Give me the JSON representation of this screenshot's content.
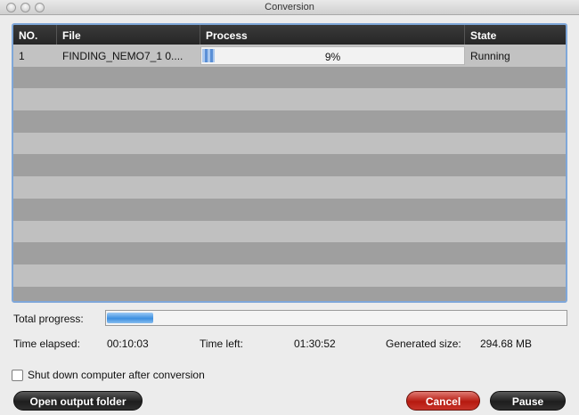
{
  "window": {
    "title": "Conversion"
  },
  "table": {
    "columns": [
      "NO.",
      "File",
      "Process",
      "State"
    ],
    "rows": [
      {
        "no": "1",
        "file": "FINDING_NEMO7_1 0....",
        "process": 0.09,
        "process_label": "9%",
        "state": "Running"
      }
    ]
  },
  "progress": {
    "label": "Total progress:",
    "value": 0.1
  },
  "stats": {
    "elapsed_label": "Time elapsed:",
    "elapsed_value": "00:10:03",
    "left_label": "Time left:",
    "left_value": "01:30:52",
    "size_label": "Generated size:",
    "size_value": "294.68 MB"
  },
  "options": {
    "shutdown_label": "Shut down computer after conversion",
    "shutdown_checked": false
  },
  "buttons": {
    "open_folder": "Open output folder",
    "cancel": "Cancel",
    "pause": "Pause"
  },
  "colors": {
    "accent_blue": "#3d8fe0",
    "cancel_red": "#b61a10",
    "header_dark": "#262626"
  }
}
